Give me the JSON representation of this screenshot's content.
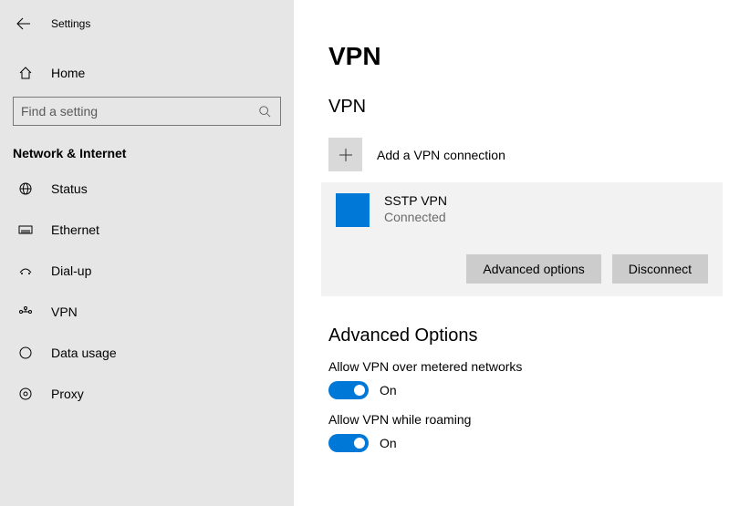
{
  "app_title": "Settings",
  "home_label": "Home",
  "search": {
    "placeholder": "Find a setting"
  },
  "category": "Network & Internet",
  "nav": [
    {
      "label": "Status"
    },
    {
      "label": "Ethernet"
    },
    {
      "label": "Dial-up"
    },
    {
      "label": "VPN"
    },
    {
      "label": "Data usage"
    },
    {
      "label": "Proxy"
    }
  ],
  "page": {
    "title": "VPN",
    "section": "VPN",
    "add_label": "Add a VPN connection",
    "connection": {
      "name": "SSTP VPN",
      "status": "Connected",
      "advanced_btn": "Advanced options",
      "disconnect_btn": "Disconnect"
    },
    "advanced_title": "Advanced Options",
    "toggle1": {
      "label": "Allow VPN over metered networks",
      "state": "On"
    },
    "toggle2": {
      "label": "Allow VPN while roaming",
      "state": "On"
    }
  }
}
